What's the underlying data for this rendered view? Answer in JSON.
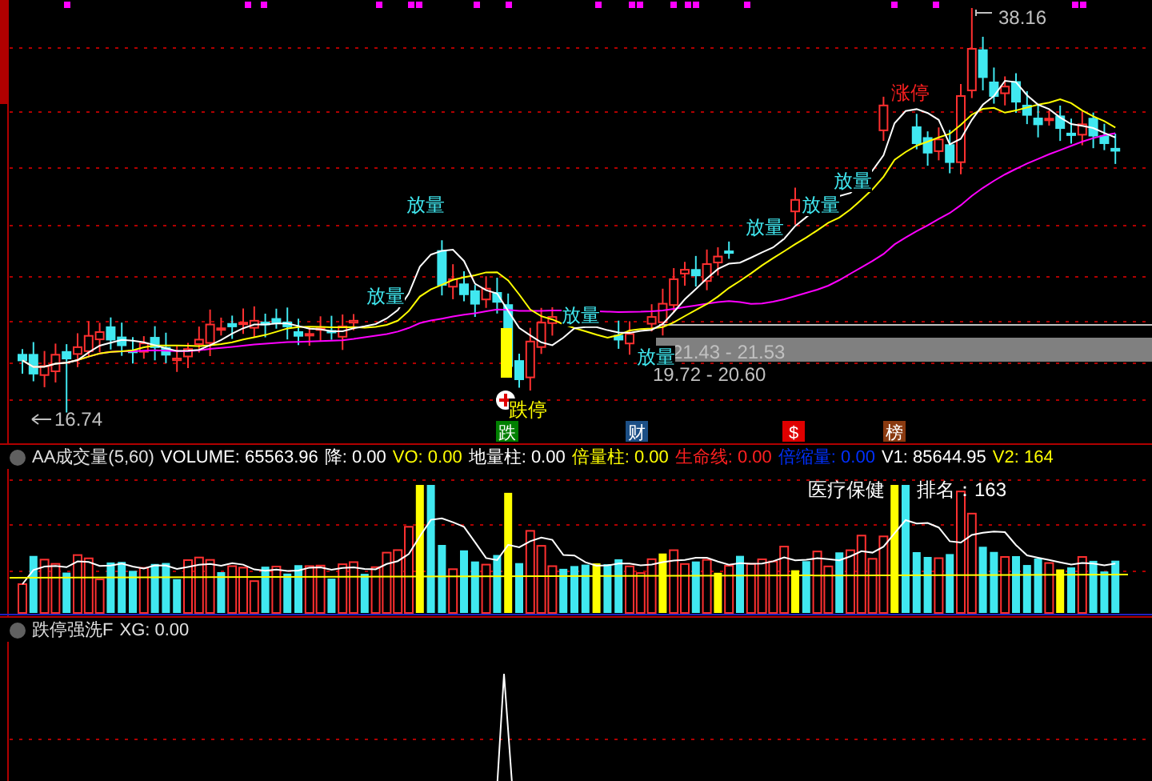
{
  "main_chart": {
    "price_labels": [
      {
        "text": "16.74",
        "kind": "low"
      },
      {
        "text": "38.16",
        "kind": "high"
      },
      {
        "text": "21.43 - 21.53",
        "kind": "band"
      },
      {
        "text": "19.72 - 20.60",
        "kind": "range"
      }
    ],
    "signals": [
      {
        "text": "放量",
        "kind": "volume"
      },
      {
        "text": "放量",
        "kind": "volume"
      },
      {
        "text": "放量",
        "kind": "volume"
      },
      {
        "text": "放量",
        "kind": "volume"
      },
      {
        "text": "放量",
        "kind": "volume"
      },
      {
        "text": "放量",
        "kind": "volume"
      },
      {
        "text": "放量",
        "kind": "volume"
      },
      {
        "text": "涨停",
        "kind": "limit-up"
      },
      {
        "text": "跌停",
        "kind": "limit-down"
      }
    ],
    "badges": [
      {
        "text": "跌",
        "color": "#008000"
      },
      {
        "text": "财",
        "color": "#1c4f86"
      },
      {
        "text": "$",
        "color": "#e00000"
      },
      {
        "text": "榜",
        "color": "#8a3a10"
      }
    ]
  },
  "volume_panel": {
    "title": "AA成交量(5,60)",
    "values": [
      {
        "label": "VOLUME:",
        "value": "65563.96",
        "color": "#ffffff"
      },
      {
        "label": "降:",
        "value": "0.00",
        "color": "#ffffff"
      },
      {
        "label": "VO:",
        "value": "0.00",
        "color": "#ffff00"
      },
      {
        "label": "地量柱:",
        "value": "0.00",
        "color": "#ffffff"
      },
      {
        "label": "倍量柱:",
        "value": "0.00",
        "color": "#ffff00"
      },
      {
        "label": "生命线:",
        "value": "0.00",
        "color": "#ff2020"
      },
      {
        "label": "倍缩量:",
        "value": "0.00",
        "color": "#0030ff"
      },
      {
        "label": "V1:",
        "value": "85644.95",
        "color": "#ffffff"
      },
      {
        "label": "V2:",
        "value": "164",
        "color": "#ffff00"
      }
    ],
    "sector": "医疗保健",
    "rank": "排名：163"
  },
  "indicator_panel": {
    "title": "跌停强洗F",
    "value": "XG: 0.00"
  }
}
